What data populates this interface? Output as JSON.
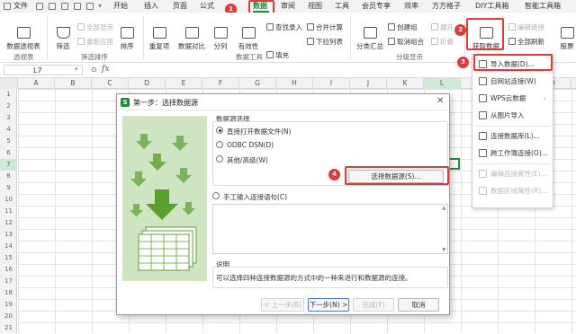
{
  "menu": {
    "file": "文件",
    "tabs": [
      "开始",
      "插入",
      "页面",
      "公式",
      "数据",
      "审阅",
      "视图",
      "工具",
      "会员专享",
      "效率",
      "方方格子",
      "DIY工具箱",
      "智能工具箱"
    ],
    "active_tab": "数据"
  },
  "steps": {
    "s1": "1",
    "s2": "2",
    "s3": "3",
    "s4": "4"
  },
  "ribbon": {
    "pivot_table": "数据透视表",
    "filter": "筛选",
    "show_all": "全部显示",
    "reapply": "重新应用",
    "sort": "排序",
    "duplicates": "重复项",
    "compare": "数据对比",
    "split": "分列",
    "validity": "有效性",
    "fill": "填充",
    "lookup_entry": "查找录入",
    "consolidate": "合并计算",
    "dropdown_list": "下拉列表",
    "subtotal": "分类汇总",
    "create_group": "创建组",
    "ungroup": "取消组合",
    "expand": "展开",
    "collapse": "折叠",
    "get_data": "获取数据",
    "edit_links": "编辑链接",
    "refresh_all": "全部刷新",
    "stocks": "股票",
    "groups": {
      "pivot": "透视表",
      "filter_sort": "筛选排序",
      "data_tools": "数据工具",
      "outline": "分级显示"
    }
  },
  "formula_bar": {
    "cell_ref": "L7",
    "fx": "fx"
  },
  "columns": [
    "A",
    "B",
    "C",
    "D",
    "E",
    "F",
    "G",
    "H",
    "I",
    "J",
    "K",
    "L",
    "M",
    "N",
    "O"
  ],
  "selected_column": "L",
  "rows": [
    "1",
    "2",
    "3",
    "4",
    "5",
    "6",
    "7",
    "8",
    "9",
    "10",
    "11",
    "12",
    "13",
    "14",
    "15",
    "16",
    "17",
    "18",
    "19",
    "20",
    "21"
  ],
  "selected_row": "7",
  "dropdown": {
    "items": [
      {
        "label": "导入数据(D)...",
        "enabled": true,
        "icon": "import-icon"
      },
      {
        "label": "自网站连接(W)",
        "enabled": true,
        "icon": "web-icon"
      },
      {
        "label": "WPS云数据",
        "enabled": true,
        "icon": "cloud-icon"
      },
      {
        "label": "从图片导入",
        "enabled": true,
        "icon": "image-icon"
      },
      {
        "label": "连接数据库(L)...",
        "enabled": true,
        "icon": "database-icon"
      },
      {
        "label": "跨工作簿连接(O)...",
        "enabled": true,
        "icon": "workbook-link-icon"
      },
      {
        "label": "编辑连接属性(E)...",
        "enabled": false,
        "icon": "edit-link-icon"
      },
      {
        "label": "数据区域属性(R)...",
        "enabled": false,
        "icon": "range-props-icon"
      }
    ]
  },
  "dialog": {
    "title": "第一步：选择数据源",
    "logo": "S",
    "source_group_title": "数据源选择",
    "opt_current_file": "直接打开数据文件(N)",
    "opt_odbc": "ODBC DSN(D)",
    "opt_other": "其他/高级(W)",
    "select_source_btn": "选择数据源(S)...",
    "opt_manual_sql": "手工输入连接语句(C)",
    "desc_title": "说明",
    "desc_text": "可以选择四种连接数据源的方式中的一种来进行和数据源的连接。",
    "btn_prev": "< 上一步(B)",
    "btn_next": "下一步(N) >",
    "btn_finish": "完成(F)",
    "btn_cancel": "取消"
  },
  "colors": {
    "accent": "#1e8a40",
    "highlight": "#e53935",
    "art_bg": "#cfe5c2",
    "art_arrow": "#5aa02c"
  }
}
